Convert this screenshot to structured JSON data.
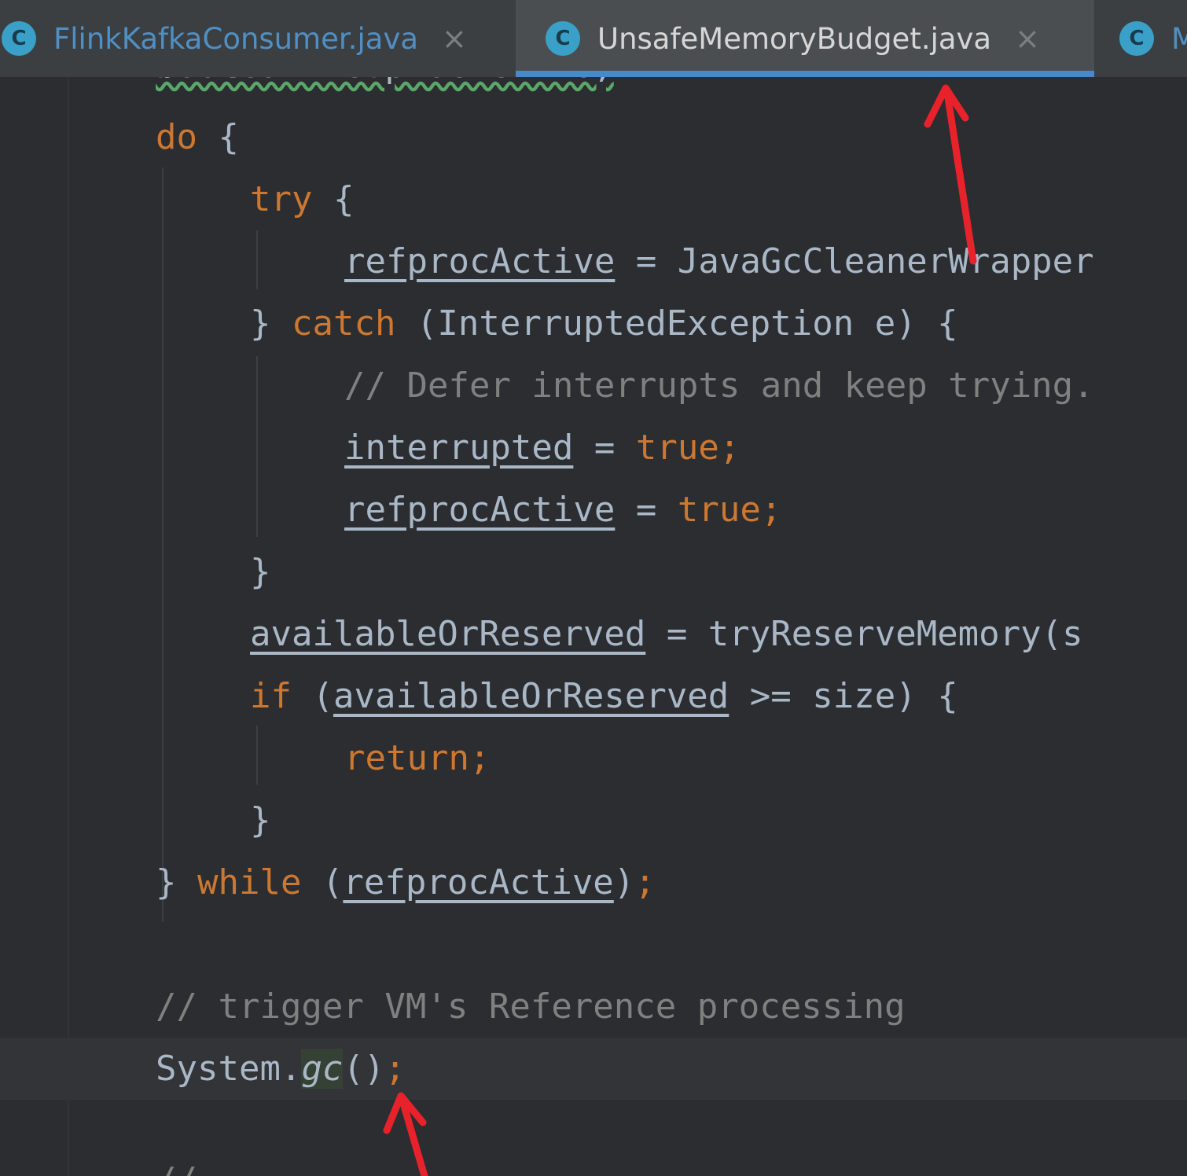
{
  "tabs": [
    {
      "label": "FlinkKafkaConsumer.java",
      "icon": "C",
      "active": false,
      "close": "×"
    },
    {
      "label": "UnsafeMemoryBudget.java",
      "icon": "C",
      "active": true,
      "close": "×"
    },
    {
      "label": "M",
      "icon": "C",
      "active": false
    }
  ],
  "code": {
    "partial_top": "boolean refprocActive;",
    "l1_do": "do",
    "l1_brace": " {",
    "l2_try": "try",
    "l2_brace": " {",
    "l3_var": "refprocActive",
    "l3_rest": " = JavaGcCleanerWrapper",
    "l4_brace": "} ",
    "l4_catch": "catch",
    "l4_rest": " (InterruptedException e) {",
    "l5_comment": "// Defer interrupts and keep trying.",
    "l6_var": "interrupted",
    "l6_eq": " = ",
    "l6_val": "true",
    "l6_semi": ";",
    "l7_var": "refprocActive",
    "l7_eq": " = ",
    "l7_val": "true",
    "l7_semi": ";",
    "l8_close": "}",
    "l9_var": "availableOrReserved",
    "l9_rest": " = tryReserveMemory(s",
    "l10_if": "if",
    "l10_open": " (",
    "l10_var": "availableOrReserved",
    "l10_rest": " >= size) {",
    "l11_return": "return",
    "l11_semi": ";",
    "l12_close": "}",
    "l13_close": "} ",
    "l13_while": "while",
    "l13_open": " (",
    "l13_var": "refprocActive",
    "l13_close2": ")",
    "l13_semi": ";",
    "l15_comment": "// trigger VM's Reference processing",
    "l16_system": "System.",
    "l16_gc": "gc",
    "l16_parens": "()",
    "l16_semi": ";"
  },
  "colors": {
    "background": "#2b2d30",
    "keyword": "#cc7832",
    "text": "#a9b7c6",
    "comment": "#808080",
    "tab_active_underline": "#4a88c7",
    "annotation_arrow": "#e8222b"
  }
}
